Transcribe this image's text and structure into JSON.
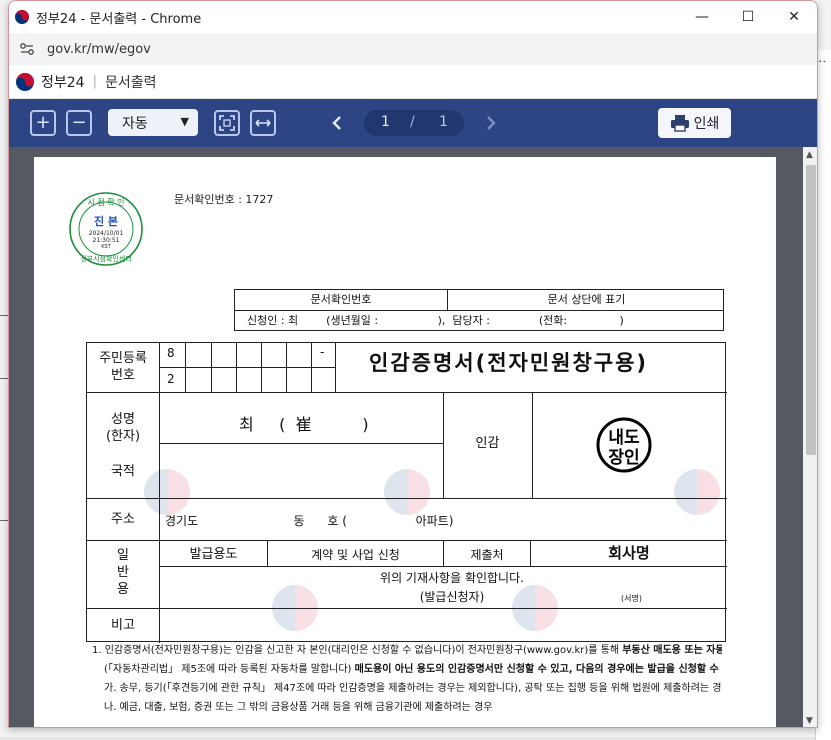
{
  "window": {
    "title": "정부24 - 문서출력 - Chrome",
    "url": "gov.kr/mw/egov"
  },
  "app_header": {
    "brand": "정부24",
    "separator": "|",
    "section": "문서출력"
  },
  "toolbar": {
    "zoom_in": "+",
    "zoom_out": "−",
    "zoom_select": "자동",
    "page_current": "1",
    "page_sep": "/",
    "page_total": "1",
    "print_label": "인쇄"
  },
  "document": {
    "doc_number": "문서확인번호 : 1727",
    "stamp": {
      "top": "시 점 확 인",
      "center": "진 본",
      "date": "2024/10/01",
      "time": "21:30:51",
      "tz": "KST",
      "bottom": "정부시점확인센터"
    },
    "topbox": {
      "h1": "문서확인번호",
      "h2": "문서 상단에 표기",
      "applicant_line": "신청인 : 최        (생년월일 :                 ),  담당자 :              (전화:               )"
    },
    "form_title": "인감증명서(전자민원창구용)",
    "resident_label": "주민등록\n번호",
    "resident_digit1": "8",
    "resident_digit2": "2",
    "resident_dash": "-",
    "name_label": "성명\n(한자)",
    "name_value": "최     (  崔          )",
    "seal_label": "인감",
    "seal_text_top": "내도",
    "seal_text_bottom": "장인",
    "nationality_label": "국적",
    "address_label": "주소",
    "address_value": "경기도                         동      호 (                  아파트)",
    "general_label": "일\n반\n용",
    "purpose_label": "발급용도",
    "purpose_value": "계약 및 사업 신청",
    "submit_label": "제출처",
    "submit_value": "회사명",
    "confirm_text": "위의 기재사항을 확인합니다.",
    "applicant_sign": "(발급신청자)",
    "sign_label": "(서명)",
    "remark_label": "비고",
    "note1a": "1. 인감증명서(전자민원창구용)는 인감을 신고한 자 본인(대리인은 신청할 수 없습니다)이 전자민원창구(www.gov.kr)를 통해 ",
    "note1b": "부동산 매도용 또는 자동차",
    "note2a": "(「자동차관리법」 제5조에 따라 등록된 자동차를 말합니다) ",
    "note2b": "매도용이 아닌 용도의 인감증명서만 신청할 수 있고, 다음의 경우에는 발급을 신청할 수 없습니다.",
    "note3": "가. 송무, 등기(「후견등기에 관한 규칙」 제47조에 따라 인감증명을 제출하려는 경우는 제외합니다), 공탁 또는 집행 등을 위해 법원에 제출하려는 경우",
    "note4": "나. 예금, 대출, 보험, 증권 또는 그 밖의 금융상품 거래 등을 위해 금융기관에 제출하려는 경우"
  }
}
